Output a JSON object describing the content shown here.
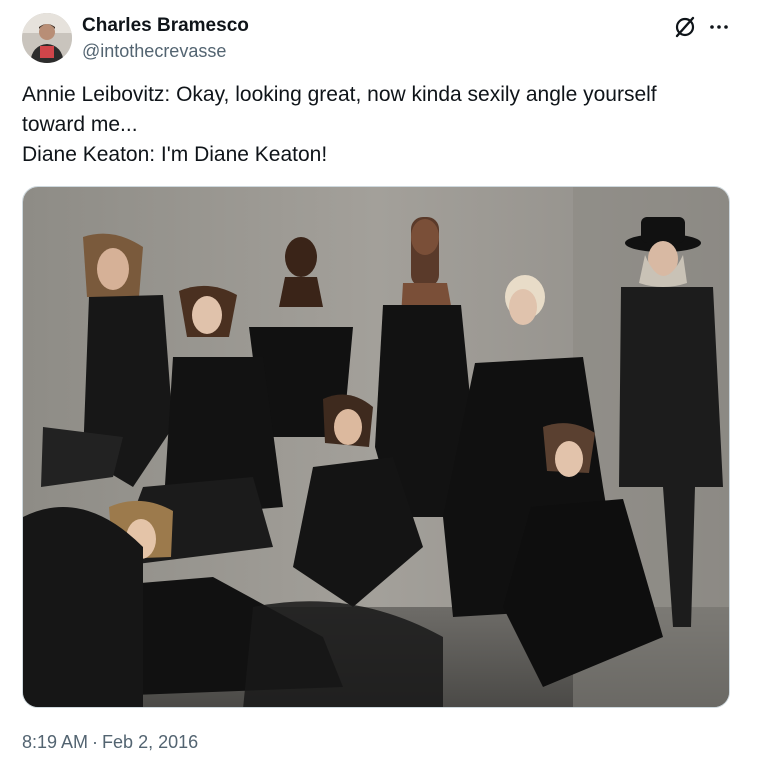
{
  "author": {
    "display_name": "Charles Bramesco",
    "handle": "@intothecrevasse"
  },
  "tweet": {
    "lines": [
      "Annie Leibovitz: Okay, looking great, now kinda sexily angle yourself",
      "toward me...",
      "Diane Keaton: I'm Diane Keaton!"
    ]
  },
  "meta": {
    "time": "8:19 AM",
    "separator": "·",
    "date": "Feb 2, 2016"
  },
  "icons": {
    "grok": "grok-icon",
    "more": "more-horizontal-icon"
  },
  "colors": {
    "text": "#0f1419",
    "secondary": "#536471",
    "border": "#cfd9de"
  }
}
